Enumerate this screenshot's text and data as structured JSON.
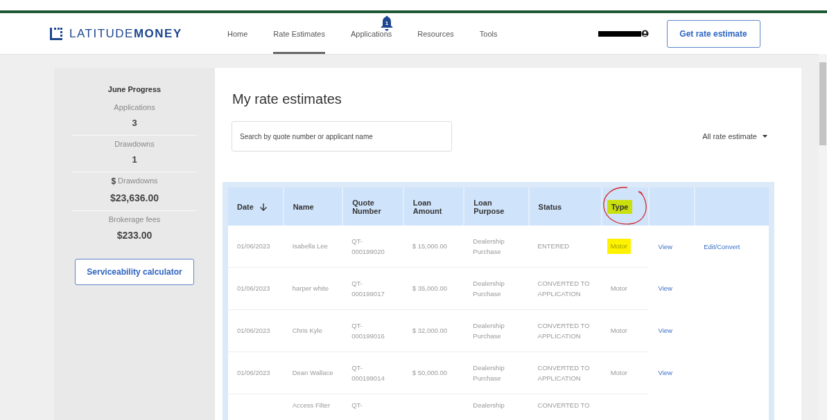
{
  "header": {
    "logo": {
      "light": "LATITUDE",
      "bold": "MONEY"
    },
    "nav": [
      {
        "label": "Home",
        "selected": false
      },
      {
        "label": "Rate Estimates",
        "selected": true
      },
      {
        "label": "Applications",
        "selected": false,
        "badge": "1"
      },
      {
        "label": "Resources",
        "selected": false
      },
      {
        "label": "Tools",
        "selected": false
      }
    ],
    "cta": "Get rate estimate"
  },
  "sidebar": {
    "title": "June Progress",
    "stats": [
      {
        "label": "Applications",
        "value": "3"
      },
      {
        "label": "Drawdowns",
        "value": "1"
      },
      {
        "prefix": "$",
        "label": "Drawdowns",
        "value": "$23,636.00"
      },
      {
        "label": "Brokerage fees",
        "value": "$233.00"
      }
    ],
    "button": "Serviceability calculator"
  },
  "main": {
    "title": "My rate estimates",
    "search": {
      "placeholder": "Search by quote number or applicant name"
    },
    "filter": "All rate estimate",
    "table": {
      "columns": [
        {
          "label": "Date",
          "sorted": true,
          "highlighted": false,
          "circled": false
        },
        {
          "label": "Name",
          "highlighted": false,
          "circled": false
        },
        {
          "label": "Quote Number",
          "highlighted": false,
          "circled": false
        },
        {
          "label": "Loan Amount",
          "highlighted": false,
          "circled": false
        },
        {
          "label": "Loan Purpose",
          "highlighted": false,
          "circled": false
        },
        {
          "label": "Status",
          "highlighted": false,
          "circled": false
        },
        {
          "label": "Type",
          "highlighted": true,
          "circled": true
        }
      ],
      "rows": [
        {
          "cells": [
            "01/06/2023",
            "Isabella Lee",
            "QT-000199020",
            "$ 15,000.00",
            "Dealership Purchase",
            "ENTERED",
            "Motor"
          ],
          "type_highlighted": true,
          "actions": [
            "View",
            "Edit/Convert"
          ]
        },
        {
          "cells": [
            "01/06/2023",
            "harper white",
            "QT-000199017",
            "$ 35,000.00",
            "Dealership Purchase",
            "CONVERTED TO APPLICATION",
            "Motor"
          ],
          "type_highlighted": false,
          "actions": [
            "View"
          ]
        },
        {
          "cells": [
            "01/06/2023",
            "Chris Kyle",
            "QT-000199016",
            "$ 32,000.00",
            "Dealership Purchase",
            "CONVERTED TO APPLICATION",
            "Motor"
          ],
          "type_highlighted": false,
          "actions": [
            "View"
          ]
        },
        {
          "cells": [
            "01/06/2023",
            "Dean Wallace",
            "QT-000199014",
            "$ 50,000.00",
            "Dealership Purchase",
            "CONVERTED TO APPLICATION",
            "Motor"
          ],
          "type_highlighted": false,
          "actions": [
            "View"
          ]
        },
        {
          "cells": [
            "",
            "Access Filter",
            "QT-",
            "",
            "Dealership",
            "CONVERTED TO",
            ""
          ],
          "actions": []
        }
      ]
    }
  }
}
